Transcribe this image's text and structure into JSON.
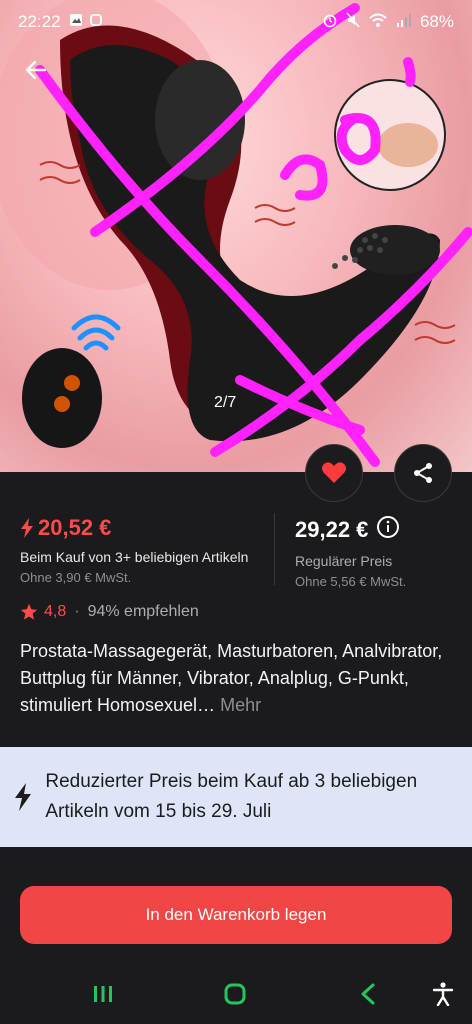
{
  "status": {
    "time": "22:22",
    "battery": "68%",
    "left_icons": [
      "image-icon",
      "app-icon"
    ],
    "right_icons": [
      "alarm-icon",
      "mute-icon",
      "wifi-icon",
      "signal-icon"
    ]
  },
  "gallery": {
    "counter": "2/7",
    "overlay_scribble_text": "90'"
  },
  "pricing": {
    "promo_price": "20,52 €",
    "promo_condition": "Beim Kauf von 3+ beliebigen Artikeln",
    "promo_tax": "Ohne 3,90 € MwSt.",
    "regular_price": "29,22 €",
    "regular_label": "Regulärer Preis",
    "regular_tax": "Ohne 5,56 € MwSt."
  },
  "rating": {
    "value": "4,8",
    "recommend": "94% empfehlen"
  },
  "product": {
    "title": "Prostata-Massagegerät, Masturbatoren, Analvibrator, Buttplug für Männer, Vibrator, Analplug, G-Punkt, stimuliert Homosexuel…",
    "more": "Mehr"
  },
  "banner": {
    "text": "Reduzierter Preis beim Kauf ab 3 beliebigen Artikeln vom 15 bis 29. Juli"
  },
  "actions": {
    "add_to_cart": "In den Warenkorb legen"
  },
  "colors": {
    "accent": "#f24545",
    "promo_red": "#ff4b4b",
    "banner_bg": "#dfe5f7",
    "nav_green": "#22c55e",
    "scribble": "#ff22ff"
  }
}
